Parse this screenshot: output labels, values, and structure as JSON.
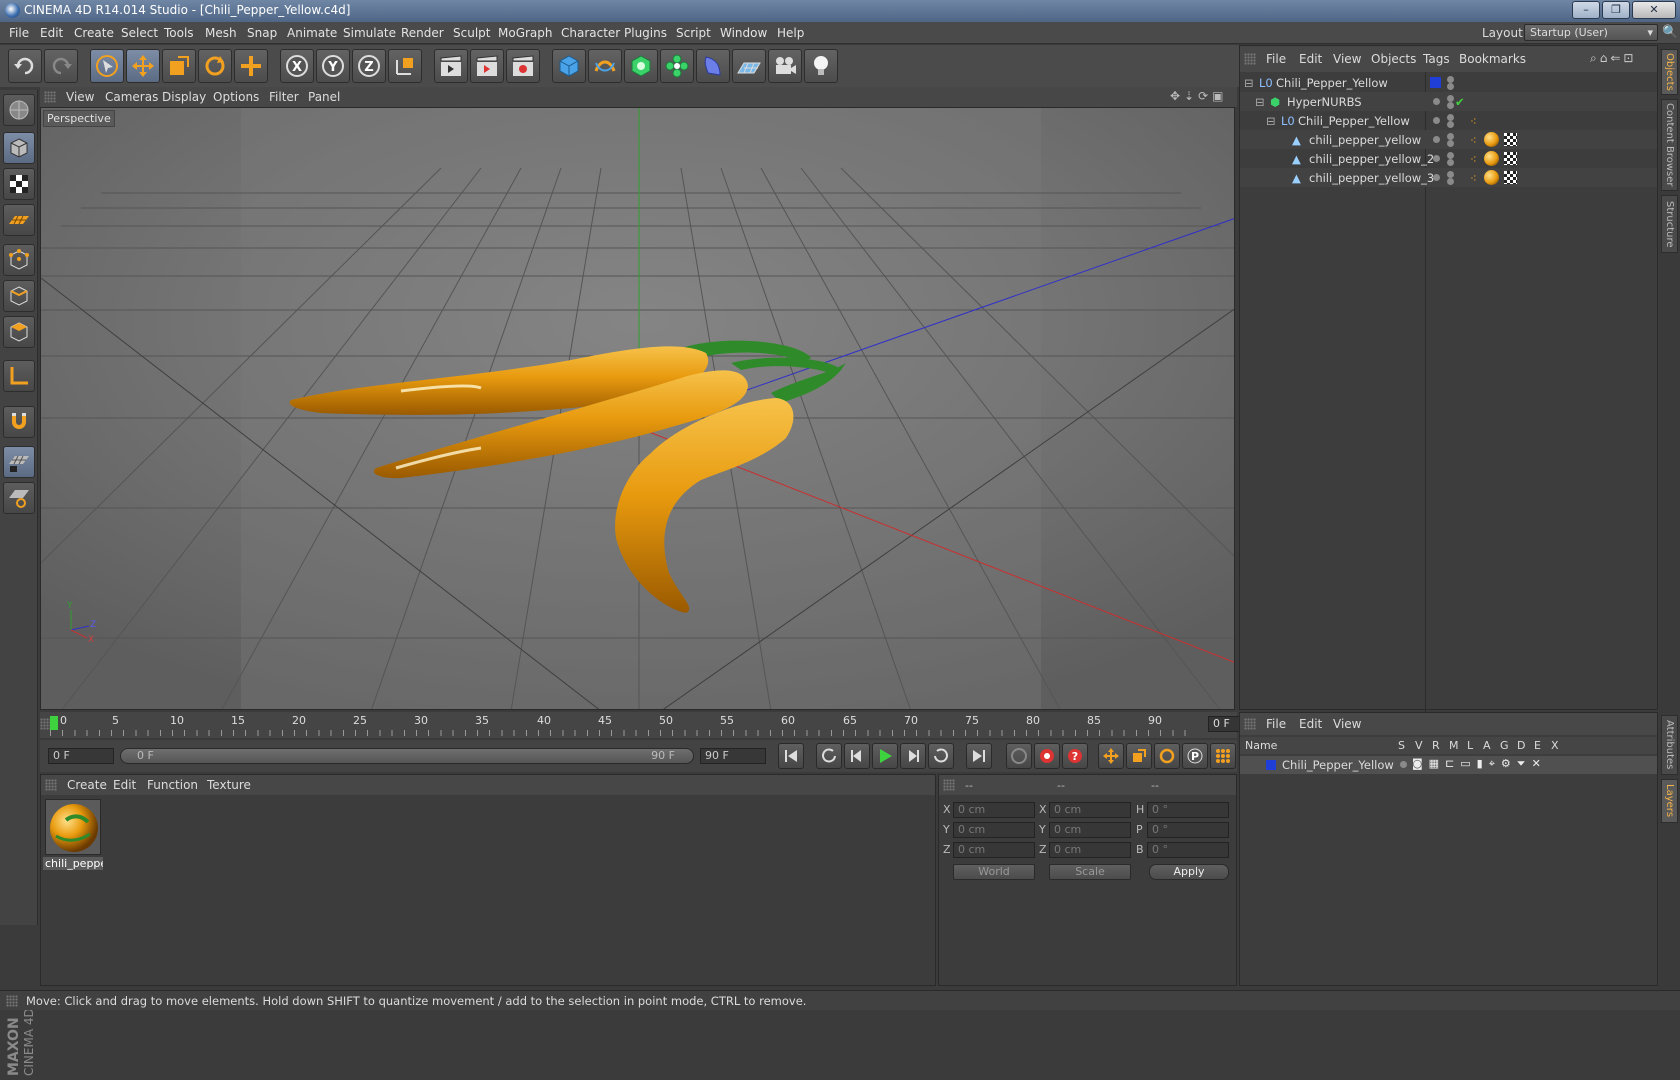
{
  "window": {
    "title": "CINEMA 4D R14.014 Studio - [Chili_Pepper_Yellow.c4d]",
    "controls": [
      "–",
      "❐",
      "✕"
    ]
  },
  "menu": [
    "File",
    "Edit",
    "Create",
    "Select",
    "Tools",
    "Mesh",
    "Snap",
    "Animate",
    "Simulate",
    "Render",
    "Sculpt",
    "MoGraph",
    "Character",
    "Plugins",
    "Script",
    "Window",
    "Help"
  ],
  "layout": {
    "label": "Layout:",
    "value": "Startup (User)"
  },
  "viewport": {
    "menu": [
      "View",
      "Cameras",
      "Display",
      "Options",
      "Filter",
      "Panel"
    ],
    "label": "Perspective",
    "axes": {
      "y": "Y",
      "z": "Z",
      "x": "X"
    }
  },
  "timeline": {
    "ticks": [
      "0",
      "5",
      "10",
      "15",
      "20",
      "25",
      "30",
      "35",
      "40",
      "45",
      "50",
      "55",
      "60",
      "65",
      "70",
      "75",
      "80",
      "85",
      "90"
    ],
    "current_frame": "0 F"
  },
  "transport": {
    "start_field": "0 F",
    "range_start": "0 F",
    "range_end": "90 F",
    "end_field": "90 F"
  },
  "materials": {
    "menu": [
      "Create",
      "Edit",
      "Function",
      "Texture"
    ],
    "items": [
      {
        "name": "chili_peppe"
      }
    ]
  },
  "coordinates": {
    "headers": [
      "--",
      "--",
      "--"
    ],
    "rows": [
      {
        "a": "X",
        "av": "0 cm",
        "b": "X",
        "bv": "0 cm",
        "c": "H",
        "cv": "0 °"
      },
      {
        "a": "Y",
        "av": "0 cm",
        "b": "Y",
        "bv": "0 cm",
        "c": "P",
        "cv": "0 °"
      },
      {
        "a": "Z",
        "av": "0 cm",
        "b": "Z",
        "bv": "0 cm",
        "c": "B",
        "cv": "0 °"
      }
    ],
    "space": "World",
    "mode": "Scale",
    "apply": "Apply"
  },
  "objects": {
    "menu": [
      "File",
      "Edit",
      "View",
      "Objects",
      "Tags",
      "Bookmarks"
    ],
    "tree": [
      {
        "name": "Chili_Pepper_Yellow"
      },
      {
        "name": "HyperNURBS"
      },
      {
        "name": "Chili_Pepper_Yellow"
      },
      {
        "name": "chili_pepper_yellow"
      },
      {
        "name": "chili_pepper_yellow_2"
      },
      {
        "name": "chili_pepper_yellow_3"
      }
    ]
  },
  "side_tabs": [
    "Objects",
    "Content Browser",
    "Structure",
    "Attributes",
    "Layers"
  ],
  "layers": {
    "menu": [
      "File",
      "Edit",
      "View"
    ],
    "columns": [
      "Name",
      "S",
      "V",
      "R",
      "M",
      "L",
      "A",
      "G",
      "D",
      "E",
      "X"
    ],
    "rows": [
      {
        "name": "Chili_Pepper_Yellow"
      }
    ]
  },
  "brand": {
    "line1": "MAXON",
    "line2": "CINEMA 4D"
  },
  "status": "Move: Click and drag to move elements. Hold down SHIFT to quantize movement / add to the selection in point mode, CTRL to remove.",
  "colors": {
    "accent": "#f2a020",
    "pepper": "#e89a0e",
    "stem": "#2f8a2a",
    "layer": "#1f3fd8"
  }
}
